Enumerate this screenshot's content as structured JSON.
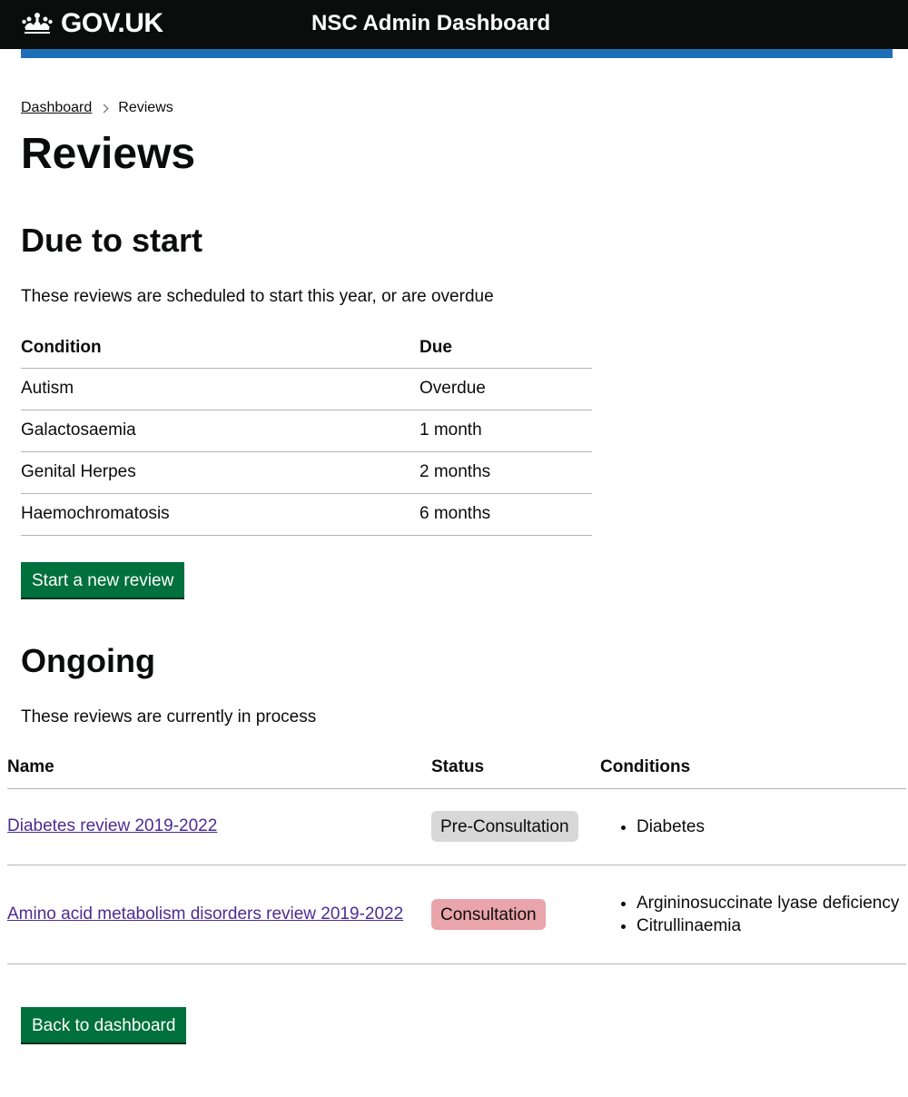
{
  "header": {
    "logo_text": "GOV.UK",
    "service_name": "NSC Admin Dashboard",
    "stripe_color": "#1d70b8"
  },
  "breadcrumbs": {
    "parent": "Dashboard",
    "current": "Reviews"
  },
  "page_title": "Reviews",
  "due_section": {
    "heading": "Due to start",
    "description": "These reviews are scheduled to start this year, or are overdue",
    "columns": [
      "Condition",
      "Due"
    ],
    "rows": [
      {
        "condition": "Autism",
        "due": "Overdue"
      },
      {
        "condition": "Galactosaemia",
        "due": "1 month"
      },
      {
        "condition": "Genital Herpes",
        "due": "2 months"
      },
      {
        "condition": "Haemochromatosis",
        "due": "6 months"
      }
    ],
    "button_label": "Start a new review"
  },
  "ongoing_section": {
    "heading": "Ongoing",
    "description": "These reviews are currently in process",
    "columns": [
      "Name",
      "Status",
      "Conditions"
    ],
    "rows": [
      {
        "name": "Diabetes review 2019-2022",
        "status": "Pre-Consultation",
        "status_color": "#d8d8d8",
        "conditions": [
          "Diabetes"
        ]
      },
      {
        "name": "Amino acid metabolism disorders review 2019-2022",
        "status": "Consultation",
        "status_color": "#eaa4ab",
        "conditions": [
          "Argininosuccinate lyase deficiency",
          "Citrullinaemia"
        ]
      }
    ]
  },
  "back_button_label": "Back to dashboard",
  "colors": {
    "button_green": "#00703c",
    "link_purple": "#4c2c92",
    "header_black": "#0b0c0c"
  }
}
